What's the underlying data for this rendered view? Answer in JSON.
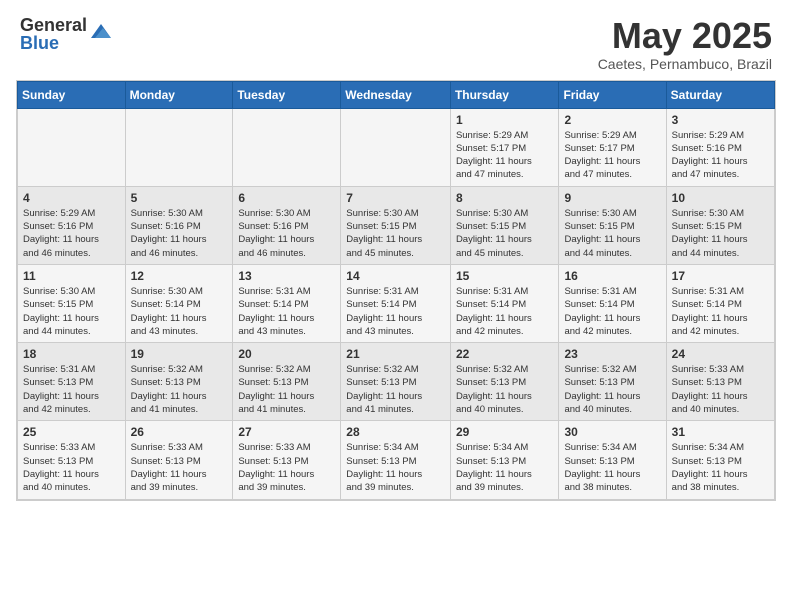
{
  "header": {
    "logo_general": "General",
    "logo_blue": "Blue",
    "title": "May 2025",
    "subtitle": "Caetes, Pernambuco, Brazil"
  },
  "calendar": {
    "days_of_week": [
      "Sunday",
      "Monday",
      "Tuesday",
      "Wednesday",
      "Thursday",
      "Friday",
      "Saturday"
    ],
    "weeks": [
      [
        {
          "day": "",
          "info": ""
        },
        {
          "day": "",
          "info": ""
        },
        {
          "day": "",
          "info": ""
        },
        {
          "day": "",
          "info": ""
        },
        {
          "day": "1",
          "info": "Sunrise: 5:29 AM\nSunset: 5:17 PM\nDaylight: 11 hours\nand 47 minutes."
        },
        {
          "day": "2",
          "info": "Sunrise: 5:29 AM\nSunset: 5:17 PM\nDaylight: 11 hours\nand 47 minutes."
        },
        {
          "day": "3",
          "info": "Sunrise: 5:29 AM\nSunset: 5:16 PM\nDaylight: 11 hours\nand 47 minutes."
        }
      ],
      [
        {
          "day": "4",
          "info": "Sunrise: 5:29 AM\nSunset: 5:16 PM\nDaylight: 11 hours\nand 46 minutes."
        },
        {
          "day": "5",
          "info": "Sunrise: 5:30 AM\nSunset: 5:16 PM\nDaylight: 11 hours\nand 46 minutes."
        },
        {
          "day": "6",
          "info": "Sunrise: 5:30 AM\nSunset: 5:16 PM\nDaylight: 11 hours\nand 46 minutes."
        },
        {
          "day": "7",
          "info": "Sunrise: 5:30 AM\nSunset: 5:15 PM\nDaylight: 11 hours\nand 45 minutes."
        },
        {
          "day": "8",
          "info": "Sunrise: 5:30 AM\nSunset: 5:15 PM\nDaylight: 11 hours\nand 45 minutes."
        },
        {
          "day": "9",
          "info": "Sunrise: 5:30 AM\nSunset: 5:15 PM\nDaylight: 11 hours\nand 44 minutes."
        },
        {
          "day": "10",
          "info": "Sunrise: 5:30 AM\nSunset: 5:15 PM\nDaylight: 11 hours\nand 44 minutes."
        }
      ],
      [
        {
          "day": "11",
          "info": "Sunrise: 5:30 AM\nSunset: 5:15 PM\nDaylight: 11 hours\nand 44 minutes."
        },
        {
          "day": "12",
          "info": "Sunrise: 5:30 AM\nSunset: 5:14 PM\nDaylight: 11 hours\nand 43 minutes."
        },
        {
          "day": "13",
          "info": "Sunrise: 5:31 AM\nSunset: 5:14 PM\nDaylight: 11 hours\nand 43 minutes."
        },
        {
          "day": "14",
          "info": "Sunrise: 5:31 AM\nSunset: 5:14 PM\nDaylight: 11 hours\nand 43 minutes."
        },
        {
          "day": "15",
          "info": "Sunrise: 5:31 AM\nSunset: 5:14 PM\nDaylight: 11 hours\nand 42 minutes."
        },
        {
          "day": "16",
          "info": "Sunrise: 5:31 AM\nSunset: 5:14 PM\nDaylight: 11 hours\nand 42 minutes."
        },
        {
          "day": "17",
          "info": "Sunrise: 5:31 AM\nSunset: 5:14 PM\nDaylight: 11 hours\nand 42 minutes."
        }
      ],
      [
        {
          "day": "18",
          "info": "Sunrise: 5:31 AM\nSunset: 5:13 PM\nDaylight: 11 hours\nand 42 minutes."
        },
        {
          "day": "19",
          "info": "Sunrise: 5:32 AM\nSunset: 5:13 PM\nDaylight: 11 hours\nand 41 minutes."
        },
        {
          "day": "20",
          "info": "Sunrise: 5:32 AM\nSunset: 5:13 PM\nDaylight: 11 hours\nand 41 minutes."
        },
        {
          "day": "21",
          "info": "Sunrise: 5:32 AM\nSunset: 5:13 PM\nDaylight: 11 hours\nand 41 minutes."
        },
        {
          "day": "22",
          "info": "Sunrise: 5:32 AM\nSunset: 5:13 PM\nDaylight: 11 hours\nand 40 minutes."
        },
        {
          "day": "23",
          "info": "Sunrise: 5:32 AM\nSunset: 5:13 PM\nDaylight: 11 hours\nand 40 minutes."
        },
        {
          "day": "24",
          "info": "Sunrise: 5:33 AM\nSunset: 5:13 PM\nDaylight: 11 hours\nand 40 minutes."
        }
      ],
      [
        {
          "day": "25",
          "info": "Sunrise: 5:33 AM\nSunset: 5:13 PM\nDaylight: 11 hours\nand 40 minutes."
        },
        {
          "day": "26",
          "info": "Sunrise: 5:33 AM\nSunset: 5:13 PM\nDaylight: 11 hours\nand 39 minutes."
        },
        {
          "day": "27",
          "info": "Sunrise: 5:33 AM\nSunset: 5:13 PM\nDaylight: 11 hours\nand 39 minutes."
        },
        {
          "day": "28",
          "info": "Sunrise: 5:34 AM\nSunset: 5:13 PM\nDaylight: 11 hours\nand 39 minutes."
        },
        {
          "day": "29",
          "info": "Sunrise: 5:34 AM\nSunset: 5:13 PM\nDaylight: 11 hours\nand 39 minutes."
        },
        {
          "day": "30",
          "info": "Sunrise: 5:34 AM\nSunset: 5:13 PM\nDaylight: 11 hours\nand 38 minutes."
        },
        {
          "day": "31",
          "info": "Sunrise: 5:34 AM\nSunset: 5:13 PM\nDaylight: 11 hours\nand 38 minutes."
        }
      ]
    ]
  }
}
